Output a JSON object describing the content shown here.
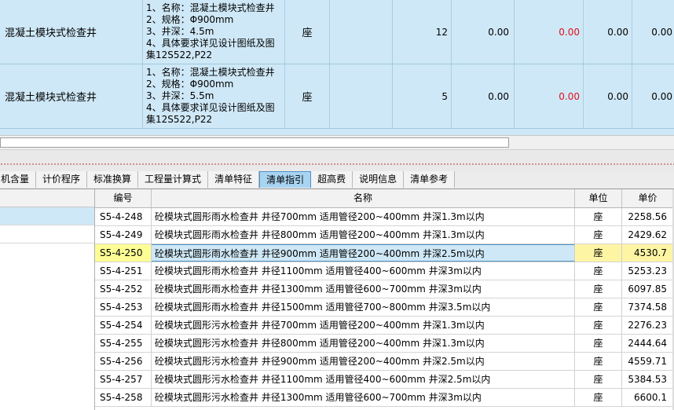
{
  "top_rows": [
    {
      "name": "混凝土模块式检查井",
      "description": "1、名称：混凝土模块式检查井\n2、规格：Φ900mm\n3、井深：4.5m\n4、具体要求详见设计图纸及图\n集12S522,P22",
      "unit": "座",
      "quantity": "12",
      "v1": "0.00",
      "v2": "0.00",
      "v3": "0.00",
      "v4": "0.00"
    },
    {
      "name": "混凝土模块式检查井",
      "description": "1、名称：混凝土模块式检查井\n2、规格：Φ900mm\n3、井深：5.5m\n4、具体要求详见设计图纸及图\n集12S522,P22",
      "unit": "座",
      "quantity": "5",
      "v1": "0.00",
      "v2": "0.00",
      "v3": "0.00",
      "v4": "0.00"
    }
  ],
  "tabs": [
    "机含量",
    "计价程序",
    "标准换算",
    "工程量计算式",
    "清单特征",
    "清单指引",
    "超高费",
    "说明信息",
    "清单参考"
  ],
  "active_tab": "清单指引",
  "table": {
    "headers": {
      "code": "编号",
      "name": "名称",
      "unit": "单位",
      "price": "单价"
    },
    "rows": [
      {
        "code": "S5-4-248",
        "name": "砼模块式圆形雨水检查井 井径700mm 适用管径200~400mm 井深1.3m以内",
        "unit": "座",
        "price": "2258.56"
      },
      {
        "code": "S5-4-249",
        "name": "砼模块式圆形雨水检查井 井径800mm 适用管径200~400mm 井深1.3m以内",
        "unit": "座",
        "price": "2429.62"
      },
      {
        "code": "S5-4-250",
        "name": "砼模块式圆形雨水检查井 井径900mm 适用管径200~400mm 井深2.5m以内",
        "unit": "座",
        "price": "4530.7",
        "selected": true
      },
      {
        "code": "S5-4-251",
        "name": "砼模块式圆形雨水检查井 井径1100mm 适用管径400~600mm 井深3m以内",
        "unit": "座",
        "price": "5253.23"
      },
      {
        "code": "S5-4-252",
        "name": "砼模块式圆形雨水检查井 井径1300mm 适用管径600~700mm 井深3m以内",
        "unit": "座",
        "price": "6097.85"
      },
      {
        "code": "S5-4-253",
        "name": "砼模块式圆形雨水检查井 井径1500mm 适用管径700~800mm 井深3.5m以内",
        "unit": "座",
        "price": "7374.58"
      },
      {
        "code": "S5-4-254",
        "name": "砼模块式圆形污水检查井 井径700mm 适用管径200~400mm 井深1.3m以内",
        "unit": "座",
        "price": "2276.23"
      },
      {
        "code": "S5-4-255",
        "name": "砼模块式圆形污水检查井 井径800mm 适用管径200~400mm 井深1.3m以内",
        "unit": "座",
        "price": "2444.64"
      },
      {
        "code": "S5-4-256",
        "name": "砼模块式圆形污水检查井 井径900mm 适用管径200~400mm 井深2.5m以内",
        "unit": "座",
        "price": "4559.71"
      },
      {
        "code": "S5-4-257",
        "name": "砼模块式圆形污水检查井 井径1100mm 适用管径400~600mm 井深2.5m以内",
        "unit": "座",
        "price": "5384.53"
      },
      {
        "code": "S5-4-258",
        "name": "砼模块式圆形污水检查井 井径1300mm 适用管径600~700mm 井深3m以内",
        "unit": "座",
        "price": "6600.1"
      }
    ]
  },
  "colors": {
    "row_highlight": "#cfe8f7",
    "selected_code": "#fdfd96",
    "negative_red": "#e0101a",
    "active_tab": "#a8d4f2"
  }
}
